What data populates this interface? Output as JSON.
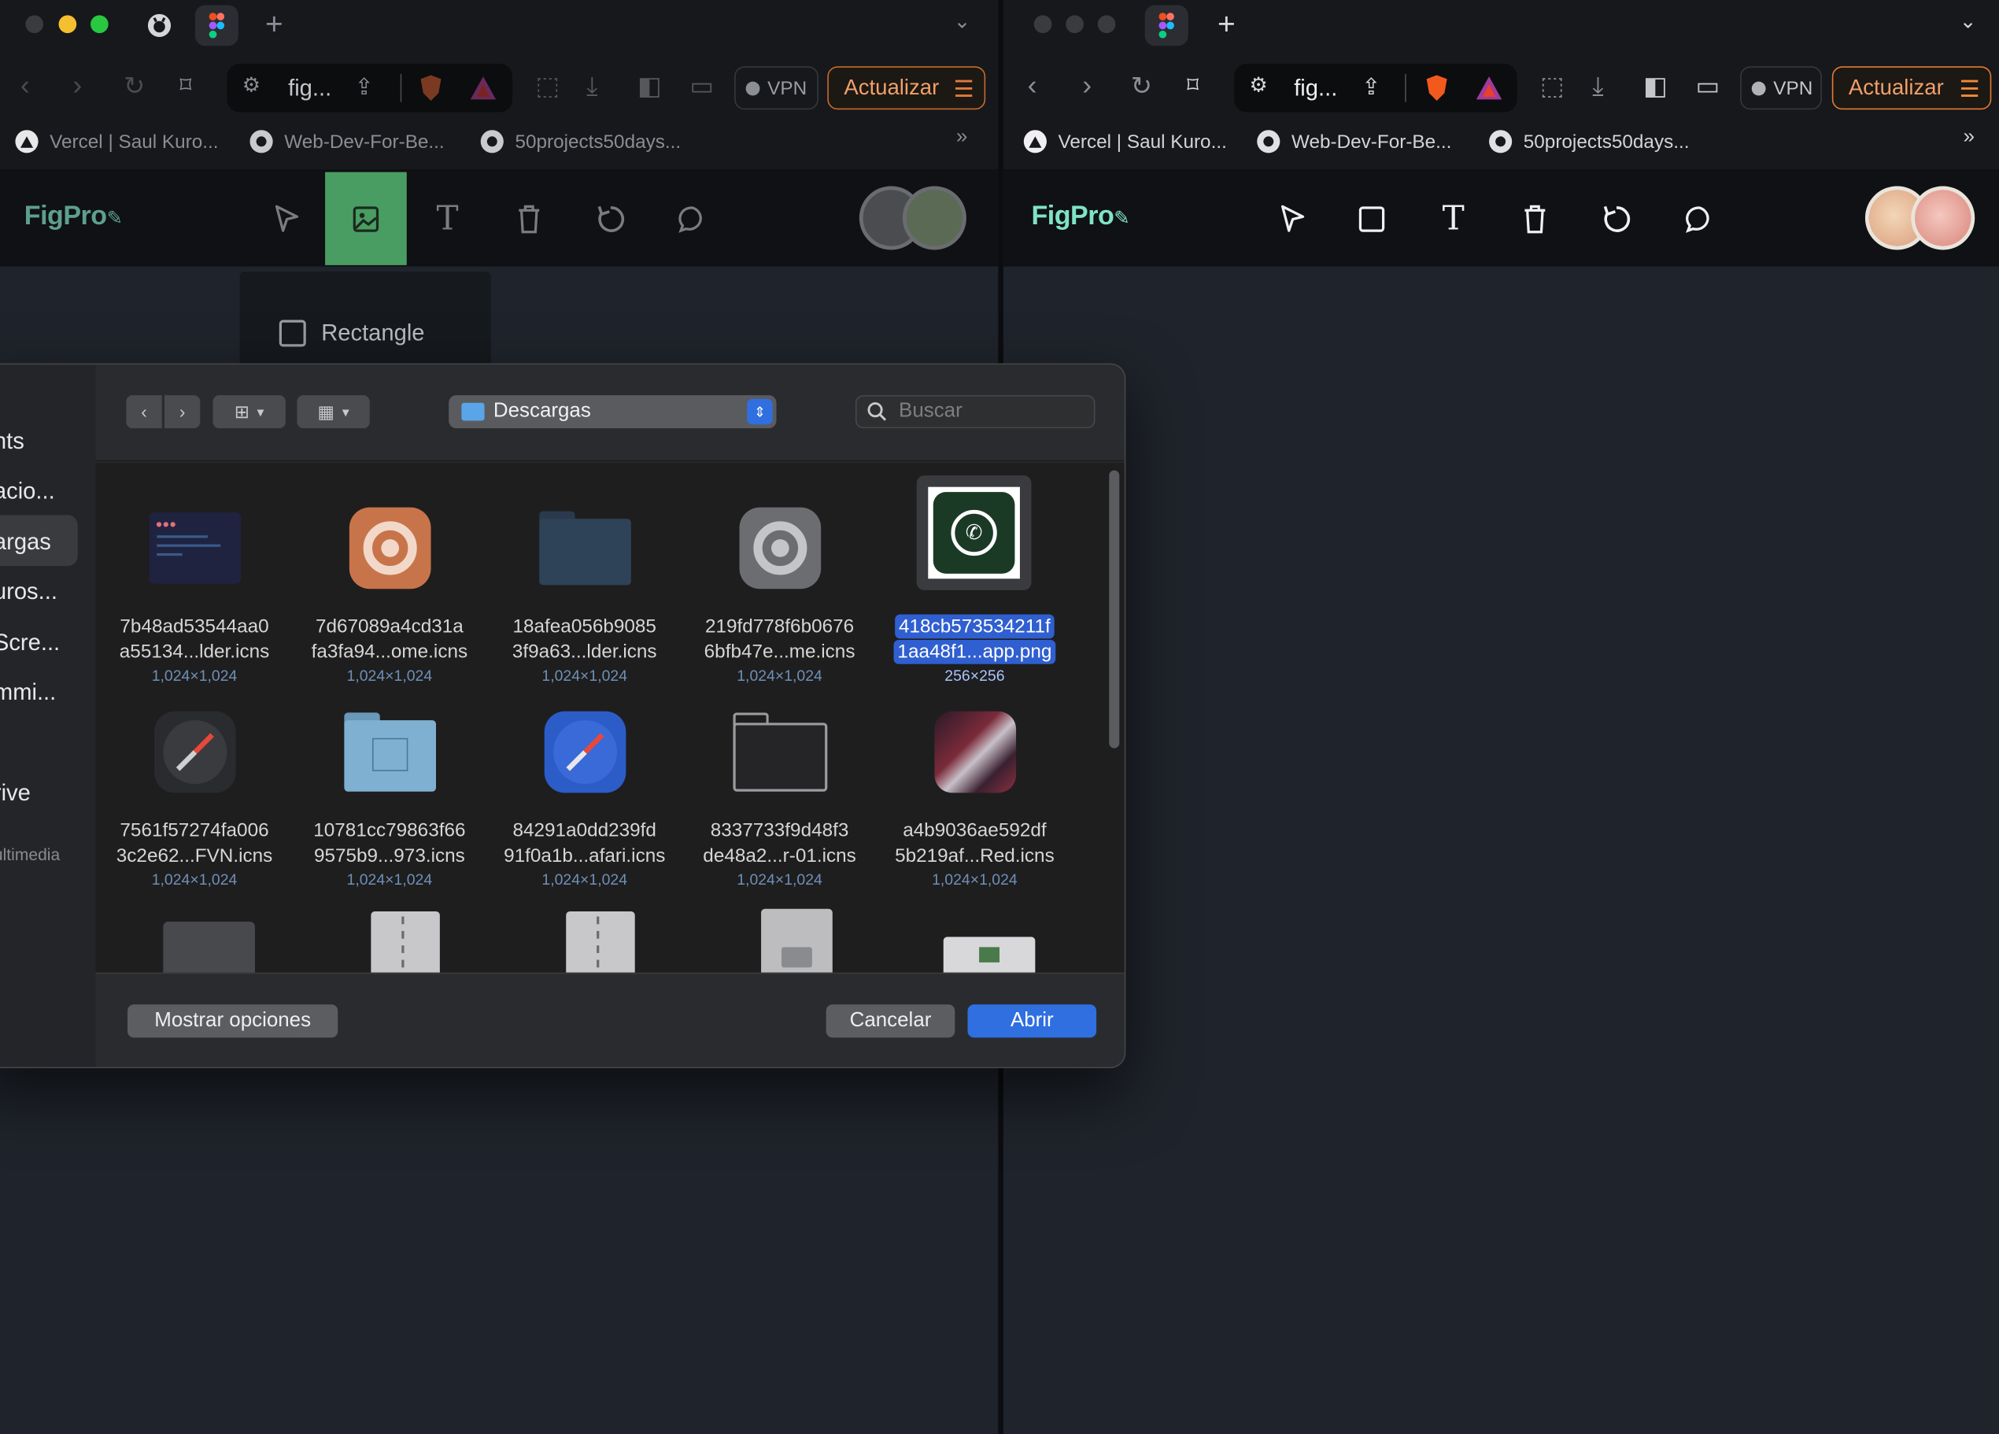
{
  "left_window": {
    "tab_title": "fig...",
    "vpn_label": "VPN",
    "update_label": "Actualizar",
    "bookmarks": [
      {
        "label": "Vercel | Saul Kuro...",
        "icon": "vercel-icon"
      },
      {
        "label": "Web-Dev-For-Be...",
        "icon": "github-icon"
      },
      {
        "label": "50projects50days...",
        "icon": "github-icon"
      }
    ],
    "more_bookmarks": "»",
    "app_logo": "FigPro",
    "dropdown_item": "Rectangle"
  },
  "right_window": {
    "tab_title": "fig...",
    "vpn_label": "VPN",
    "update_label": "Actualizar",
    "bookmarks": [
      {
        "label": "Vercel | Saul Kuro...",
        "icon": "vercel-icon"
      },
      {
        "label": "Web-Dev-For-Be...",
        "icon": "github-icon"
      },
      {
        "label": "50projects50days...",
        "icon": "github-icon"
      }
    ],
    "more_bookmarks": "»",
    "app_logo": "FigPro"
  },
  "tools": [
    "cursor-icon",
    "image-icon",
    "text-icon",
    "trash-icon",
    "reset-icon",
    "comment-icon"
  ],
  "file_dialog": {
    "location": "Descargas",
    "search_placeholder": "Buscar",
    "sidebar": [
      {
        "label": "nts"
      },
      {
        "label": "acio..."
      },
      {
        "label": "argas",
        "selected": true
      },
      {
        "label": "uros..."
      },
      {
        "label": "Scre..."
      },
      {
        "label": "mmi..."
      },
      {
        "label": "rive"
      },
      {
        "label": "ultimedia",
        "section": true
      }
    ],
    "files": [
      {
        "line1": "7b48ad53544aa0",
        "line2": "a55134...lder.icns",
        "dims": "1,024×1,024",
        "kind": "code"
      },
      {
        "line1": "7d67089a4cd31a",
        "line2": "fa3fa94...ome.icns",
        "dims": "1,024×1,024",
        "kind": "chrome-orange"
      },
      {
        "line1": "18afea056b9085",
        "line2": "3f9a63...lder.icns",
        "dims": "1,024×1,024",
        "kind": "folder-dark"
      },
      {
        "line1": "219fd778f6b0676",
        "line2": "6bfb47e...me.icns",
        "dims": "1,024×1,024",
        "kind": "chrome-gray"
      },
      {
        "line1": "418cb573534211f",
        "line2": "1aa48f1...app.png",
        "dims": "256×256",
        "kind": "whatsapp",
        "selected": true
      },
      {
        "line1": "7561f57274fa006",
        "line2": "3c2e62...FVN.icns",
        "dims": "1,024×1,024",
        "kind": "compass-dark"
      },
      {
        "line1": "10781cc79863f66",
        "line2": "9575b9...973.icns",
        "dims": "1,024×1,024",
        "kind": "folder-blue"
      },
      {
        "line1": "84291a0dd239fd",
        "line2": "91f0a1b...afari.icns",
        "dims": "1,024×1,024",
        "kind": "safari"
      },
      {
        "line1": "8337733f9d48f3",
        "line2": "de48a2...r-01.icns",
        "dims": "1,024×1,024",
        "kind": "folder-outline"
      },
      {
        "line1": "a4b9036ae592df",
        "line2": "5b219af...Red.icns",
        "dims": "1,024×1,024",
        "kind": "wallpaper"
      }
    ],
    "buttons": {
      "options": "Mostrar opciones",
      "cancel": "Cancelar",
      "open": "Abrir"
    }
  },
  "colors": {
    "accent": "#2f6fe0",
    "logo": "#7fe3c4",
    "active_tool": "#4a9d62",
    "update_border": "#c86a2a"
  }
}
